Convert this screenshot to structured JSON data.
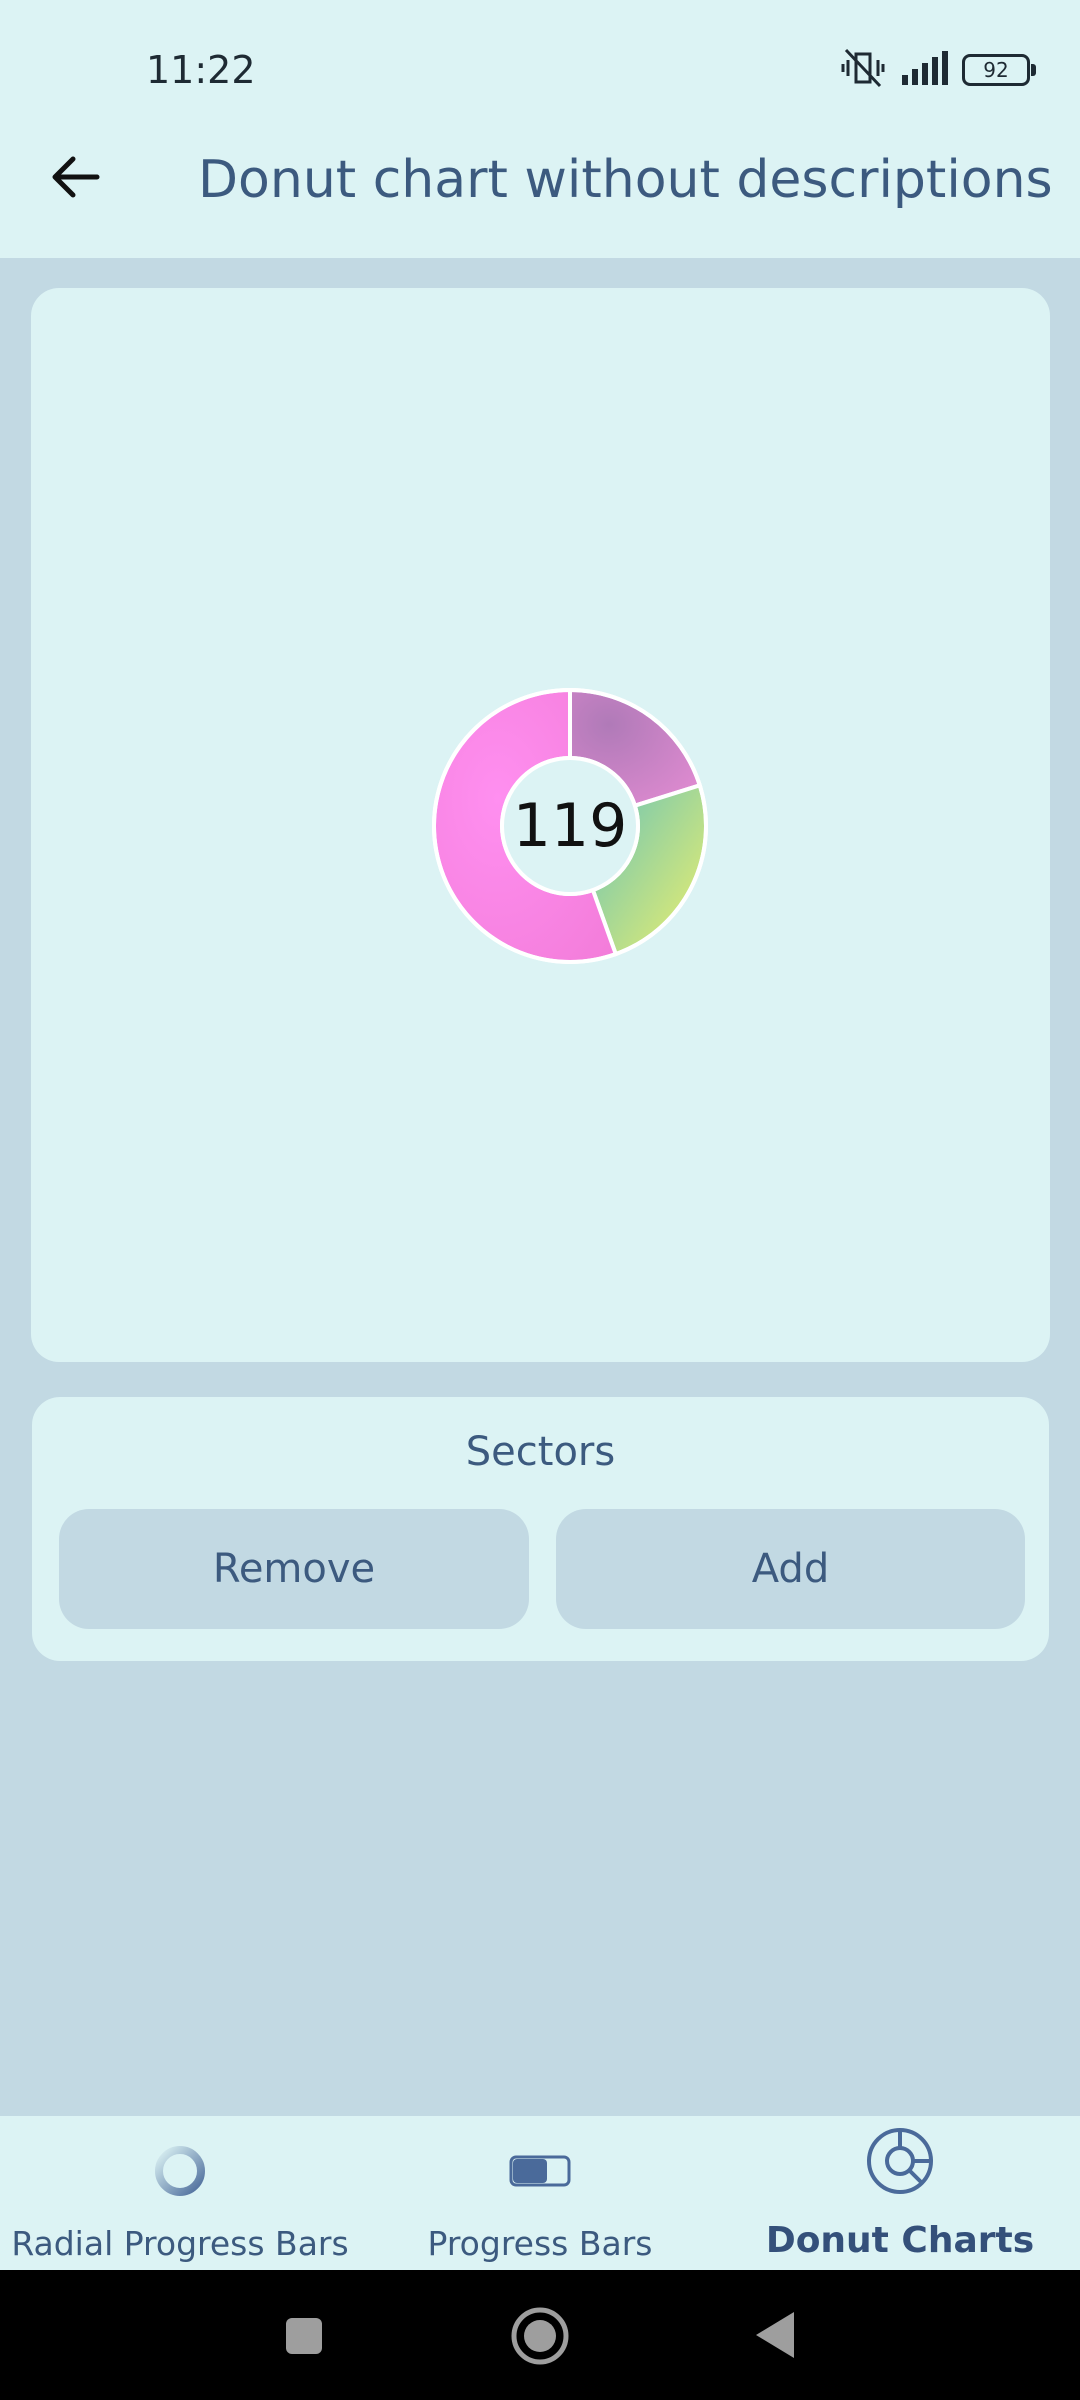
{
  "status_bar": {
    "time": "11:22",
    "battery": "92"
  },
  "app_bar": {
    "title": "Donut chart without descriptions",
    "back_icon": "arrow-left-icon"
  },
  "chart_data": {
    "type": "pie",
    "center_label": "119",
    "slices": [
      {
        "value": 24,
        "color_start": "#c97bbf",
        "color_end": "#e59ad0"
      },
      {
        "value": 29,
        "color_start": "#6fc7b5",
        "color_end": "#e9ec6f"
      },
      {
        "value": 66,
        "color_start": "#fb8ae8",
        "color_end": "#f47fd9"
      }
    ],
    "total": 119
  },
  "sectors": {
    "title": "Sectors",
    "remove_label": "Remove",
    "add_label": "Add"
  },
  "bottom_nav": {
    "items": [
      {
        "label": "Radial Progress Bars",
        "icon": "radial-progress-icon",
        "active": false
      },
      {
        "label": "Progress Bars",
        "icon": "progress-bar-icon",
        "active": false
      },
      {
        "label": "Donut Charts",
        "icon": "donut-chart-icon",
        "active": true
      }
    ]
  },
  "colors": {
    "background": "#c2d9e3",
    "card": "#dcf3f4",
    "accent_text": "#3c5a7f"
  }
}
